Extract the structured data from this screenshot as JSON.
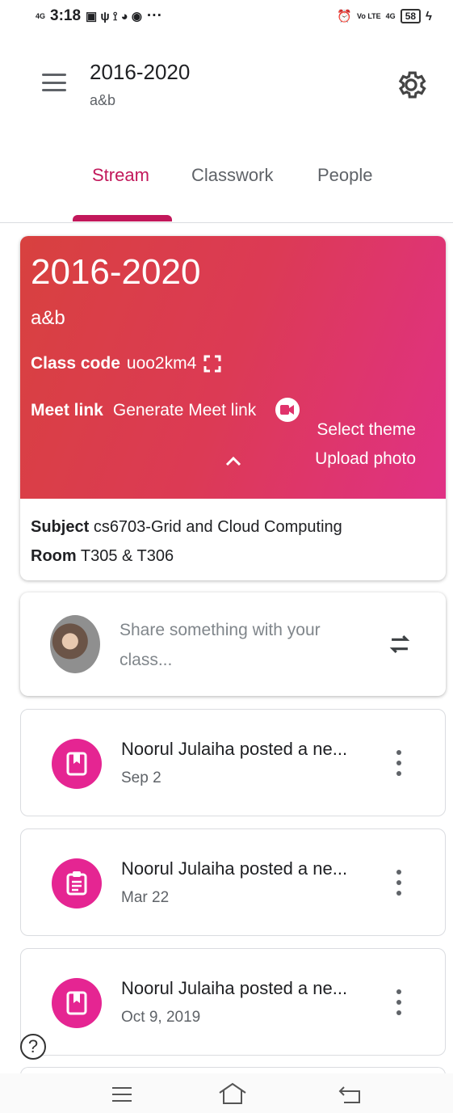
{
  "status_bar": {
    "network": "4G",
    "time": "3:18",
    "right_network": "4G",
    "volte": "Vo LTE",
    "battery": "58",
    "more": "···"
  },
  "header": {
    "title": "2016-2020",
    "subtitle": "a&b"
  },
  "tabs": [
    {
      "label": "Stream",
      "active": true
    },
    {
      "label": "Classwork",
      "active": false
    },
    {
      "label": "People",
      "active": false
    }
  ],
  "banner": {
    "title": "2016-2020",
    "subtitle": "a&b",
    "class_code_label": "Class code",
    "class_code": "uoo2km4",
    "meet_label": "Meet link",
    "meet_action": "Generate Meet link",
    "select_theme": "Select theme",
    "upload_photo": "Upload photo",
    "subject_label": "Subject",
    "subject": "cs6703-Grid and Cloud Computing",
    "room_label": "Room",
    "room": "T305 & T306",
    "colors": {
      "start": "#d8413f",
      "end": "#e03185"
    }
  },
  "share": {
    "placeholder": "Share something with your class..."
  },
  "posts": [
    {
      "title": "Noorul Julaiha posted a ne...",
      "date": "Sep 2",
      "icon": "bookmark-icon"
    },
    {
      "title": "Noorul Julaiha posted a ne...",
      "date": "Mar 22",
      "icon": "assignment-icon"
    },
    {
      "title": "Noorul Julaiha posted a ne...",
      "date": "Oct 9, 2019",
      "icon": "bookmark-icon"
    }
  ],
  "help": {
    "glyph": "?"
  },
  "colors": {
    "accent": "#c2185b",
    "post_icon_bg": "#e52592"
  }
}
